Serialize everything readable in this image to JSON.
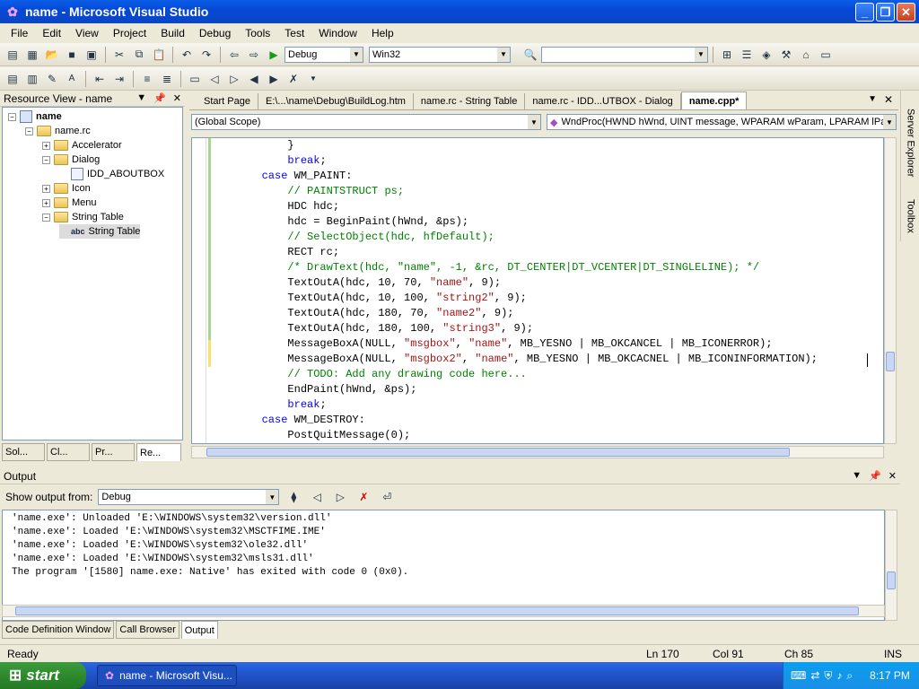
{
  "window": {
    "title": "name - Microsoft Visual Studio"
  },
  "menu": [
    "File",
    "Edit",
    "View",
    "Project",
    "Build",
    "Debug",
    "Tools",
    "Test",
    "Window",
    "Help"
  ],
  "toolbar": {
    "config": "Debug",
    "platform": "Win32",
    "find": ""
  },
  "resource_view": {
    "title": "Resource View - name",
    "tree": [
      {
        "label": "name",
        "level": 0,
        "expander": "−",
        "icon": "project"
      },
      {
        "label": "name.rc",
        "level": 1,
        "expander": "−",
        "icon": "folder"
      },
      {
        "label": "Accelerator",
        "level": 2,
        "expander": "+",
        "icon": "folder"
      },
      {
        "label": "Dialog",
        "level": 2,
        "expander": "−",
        "icon": "folder"
      },
      {
        "label": "IDD_ABOUTBOX",
        "level": 3,
        "expander": "",
        "icon": "file"
      },
      {
        "label": "Icon",
        "level": 2,
        "expander": "+",
        "icon": "folder"
      },
      {
        "label": "Menu",
        "level": 2,
        "expander": "+",
        "icon": "folder"
      },
      {
        "label": "String Table",
        "level": 2,
        "expander": "−",
        "icon": "folder"
      },
      {
        "label": "String Table",
        "level": 3,
        "expander": "",
        "icon": "abc",
        "selected": true
      }
    ],
    "tabs": [
      "Sol...",
      "Cl...",
      "Pr...",
      "Re..."
    ]
  },
  "editor": {
    "tabs": [
      "Start Page",
      "E:\\...\\name\\Debug\\BuildLog.htm",
      "name.rc - String Table",
      "name.rc - IDD...UTBOX - Dialog",
      "name.cpp*"
    ],
    "active_tab": 4,
    "scope": "(Global Scope)",
    "function": "WndProc(HWND hWnd, UINT message, WPARAM wParam, LPARAM lPara",
    "lines": [
      "            }",
      "            break;",
      "        case WM_PAINT:",
      "            // PAINTSTRUCT ps;",
      "            HDC hdc;",
      "            hdc = BeginPaint(hWnd, &ps);",
      "            // SelectObject(hdc, hfDefault);",
      "            RECT rc;",
      "            /* DrawText(hdc, \"name\", -1, &rc, DT_CENTER|DT_VCENTER|DT_SINGLELINE); */",
      "            TextOutA(hdc, 10, 70, \"name\", 9);",
      "            TextOutA(hdc, 10, 100, \"string2\", 9);",
      "            TextOutA(hdc, 180, 70, \"name2\", 9);",
      "            TextOutA(hdc, 180, 100, \"string3\", 9);",
      "            MessageBoxA(NULL, \"msgbox\", \"name\", MB_YESNO | MB_OKCANCEL | MB_ICONERROR);",
      "            MessageBoxA(NULL, \"msgbox2\", \"name\", MB_YESNO | MB_OKCACNEL | MB_ICONINFORMATION);",
      "            // TODO: Add any drawing code here...",
      "            EndPaint(hWnd, &ps);",
      "            break;",
      "        case WM_DESTROY:",
      "            PostQuitMessage(0);"
    ]
  },
  "side_tabs": [
    "Server Explorer",
    "Toolbox"
  ],
  "output": {
    "title": "Output",
    "show_from_label": "Show output from:",
    "source": "Debug",
    "lines": [
      "'name.exe': Unloaded 'E:\\WINDOWS\\system32\\version.dll'",
      "'name.exe': Loaded 'E:\\WINDOWS\\system32\\MSCTFIME.IME'",
      "'name.exe': Loaded 'E:\\WINDOWS\\system32\\ole32.dll'",
      "'name.exe': Loaded 'E:\\WINDOWS\\system32\\msls31.dll'",
      "The program '[1580] name.exe: Native' has exited with code 0 (0x0)."
    ],
    "tabs": [
      "Code Definition Window",
      "Call Browser",
      "Output"
    ],
    "active_tab": 2
  },
  "status": {
    "text": "Ready",
    "ln": "Ln 170",
    "col": "Col 91",
    "ch": "Ch 85",
    "mode": "INS"
  },
  "taskbar": {
    "start": "start",
    "item": "name - Microsoft Visu...",
    "clock": "8:17 PM"
  }
}
